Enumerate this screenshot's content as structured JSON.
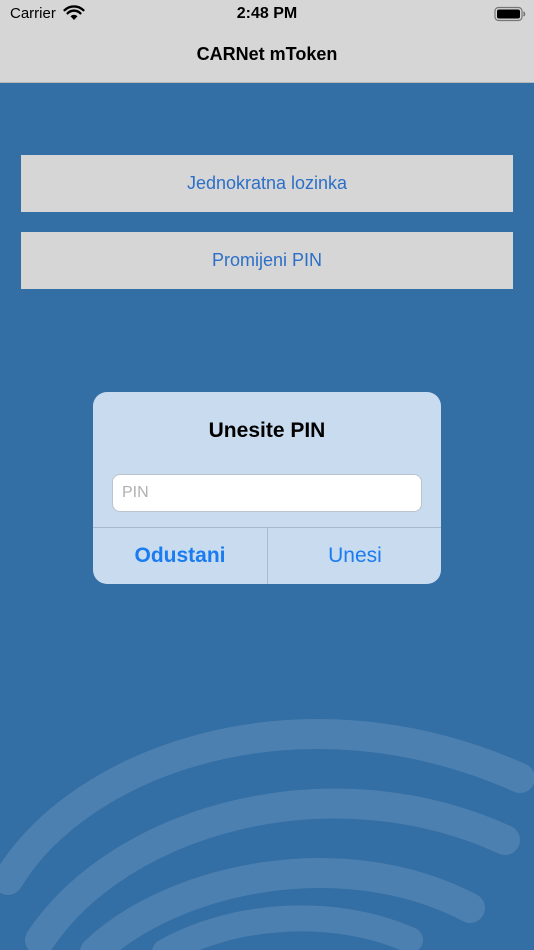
{
  "status_bar": {
    "carrier": "Carrier",
    "time": "2:48 PM",
    "icons": [
      "wifi-icon",
      "battery-icon"
    ]
  },
  "nav": {
    "title": "CARNet mToken"
  },
  "menu": {
    "otp_label": "Jednokratna lozinka",
    "change_pin_label": "Promijeni PIN"
  },
  "dialog": {
    "title": "Unesite PIN",
    "input_placeholder": "PIN",
    "input_value": "",
    "cancel_label": "Odustani",
    "confirm_label": "Unesi"
  },
  "colors": {
    "background": "#336ea4",
    "bar_gray": "#d6d6d6",
    "button_text": "#2c6fc8",
    "dialog_bg": "#c9dcef",
    "dialog_action": "#1a7cf0"
  },
  "decoration": {
    "icon": "fingerprint-icon"
  }
}
